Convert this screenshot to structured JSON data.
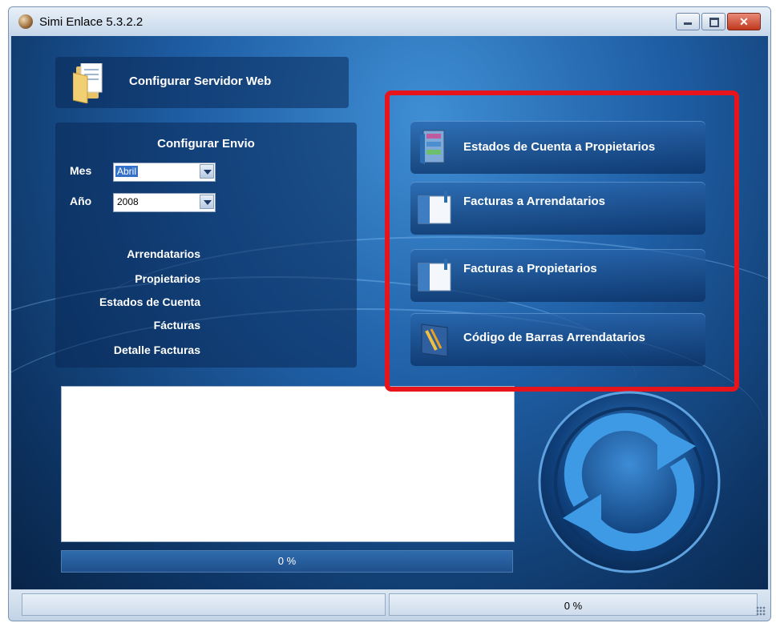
{
  "window": {
    "title": "Simi Enlace 5.3.2.2",
    "close_glyph": "✕"
  },
  "server": {
    "label": "Configurar Servidor Web"
  },
  "config": {
    "title": "Configurar Envio",
    "mes_label": "Mes",
    "mes_value": "Abril",
    "anio_label": "Año",
    "anio_value": "2008",
    "tables": [
      "Arrendatarios",
      "Propietarios",
      "Estados de Cuenta",
      "Fácturas",
      "Detalle Facturas"
    ]
  },
  "actions": [
    {
      "label": "Estados de Cuenta a Propietarios",
      "icon": "statements-icon"
    },
    {
      "label": "Facturas a Arrendatarios",
      "icon": "invoice-icon"
    },
    {
      "label": "Facturas a Propietarios",
      "icon": "invoice-icon"
    },
    {
      "label": "Código de Barras Arrendatarios",
      "icon": "barcode-icon"
    }
  ],
  "progress": {
    "text": "0 %",
    "value": 0
  },
  "status": {
    "left": "",
    "right": "0 %"
  },
  "colors": {
    "highlight": "#e8141b",
    "background": "#1f5fa6"
  }
}
